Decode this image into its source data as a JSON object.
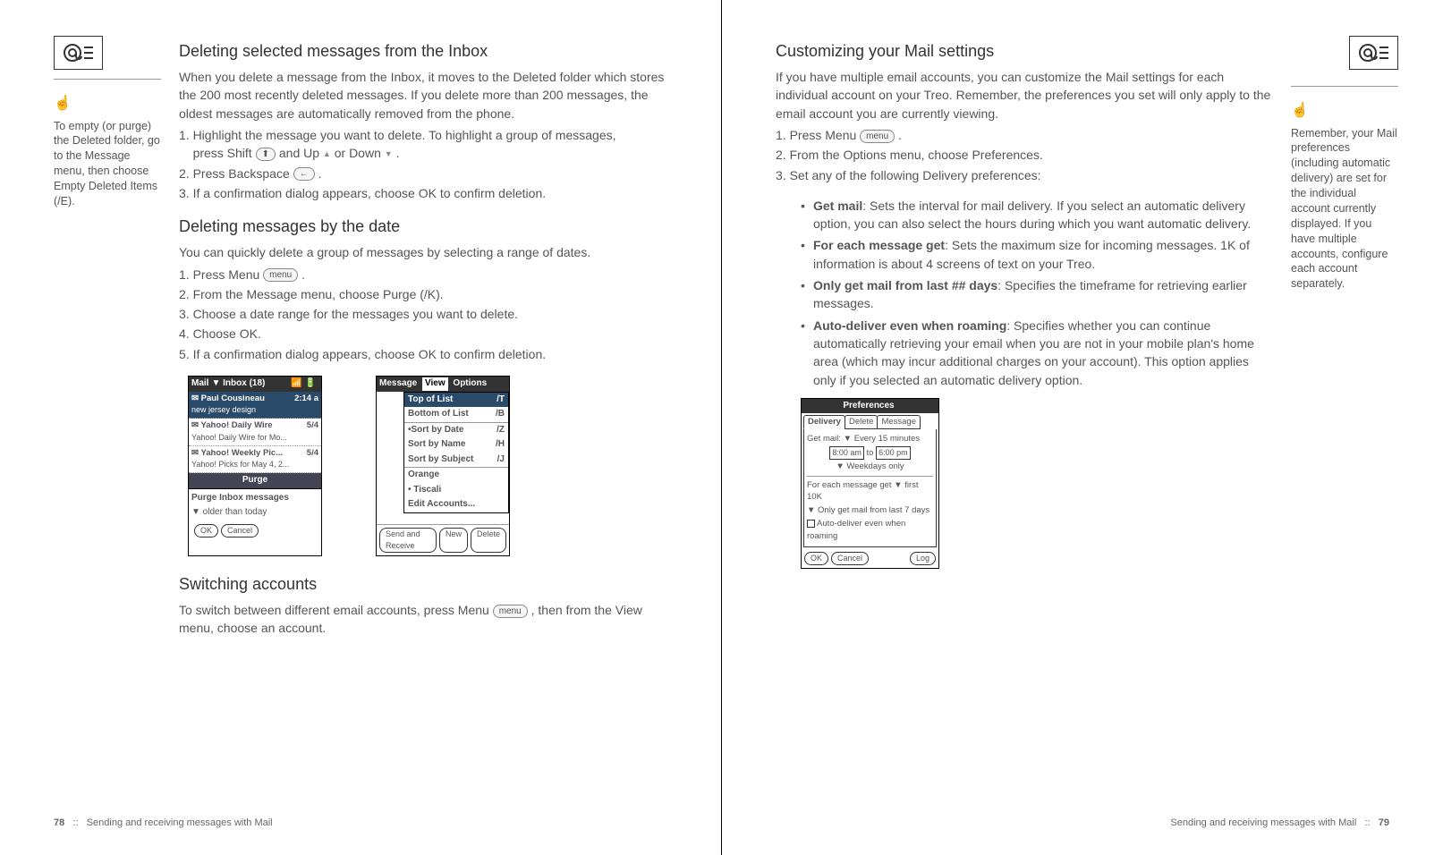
{
  "left_page": {
    "sidebar_tip": "To empty (or purge) the Deleted folder, go to the Message menu, then choose Empty Deleted Items (/E).",
    "h1": "Deleting selected messages from the Inbox",
    "p1": "When you delete a message from the Inbox, it moves to the Deleted folder which stores the 200 most recently deleted messages. If you delete more than 200 messages, the oldest messages are automatically removed from the phone.",
    "s1_li1a": "1.  Highlight the message you want to delete. To highlight a group of messages,",
    "s1_li1b": "press Shift",
    "s1_li1c": "and Up",
    "s1_li1d": "or Down",
    "s1_li2": "2.  Press Backspace",
    "s1_li3": "3.  If a confirmation dialog appears, choose OK to confirm deletion.",
    "h2": "Deleting messages by the date",
    "p2": "You can quickly delete a group of messages by selecting a range of dates.",
    "s2_li1": "1.  Press Menu",
    "s2_li2": "2.  From the Message menu, choose Purge (/K).",
    "s2_li3": "3.  Choose a date range for the messages you want to delete.",
    "s2_li4": "4.  Choose OK.",
    "s2_li5": "5.  If a confirmation dialog appears, choose OK to confirm deletion.",
    "h3": "Switching accounts",
    "p3a": "To switch between different email accounts, press Menu",
    "p3b": ", then from the View menu, choose an account.",
    "footer_num": "78",
    "footer_sep": "::",
    "footer_text": "Sending and receiving messages with Mail",
    "shot_a": {
      "title_mail": "Mail",
      "title_inbox": "▼ Inbox (18)",
      "r1_name": "Paul Cousineau",
      "r1_time": "2:14 a",
      "r1_sub": "new jersey design",
      "r2_name": "Yahoo! Daily Wire",
      "r2_date": "5/4",
      "r2_sub": "Yahoo! Daily Wire for Mo...",
      "r3_name": "Yahoo! Weekly Pic...",
      "r3_date": "5/4",
      "r3_sub": "Yahoo! Picks for May 4, 2...",
      "purge": "Purge",
      "dlg_title": "Purge Inbox messages",
      "dlg_opt": "▼ older than today",
      "ok": "OK",
      "cancel": "Cancel"
    },
    "shot_b": {
      "m1": "Message",
      "m2": "View",
      "m3": "Options",
      "top": "Top of List",
      "top_k": "/T",
      "bot": "Bottom of List",
      "bot_k": "/B",
      "date": "•Sort by Date",
      "date_k": "/Z",
      "name": "Sort by Name",
      "name_k": "/H",
      "subj": "Sort by Subject",
      "subj_k": "/J",
      "acc1": "Orange",
      "acc2": "• Tiscali",
      "acc3": "Edit Accounts...",
      "b1": "Send and Receive",
      "b2": "New",
      "b3": "Delete"
    }
  },
  "right_page": {
    "sidebar_tip": "Remember, your Mail preferences (including automatic delivery) are set for the individual account currently displayed. If you have multiple accounts, configure each account separately.",
    "h1": "Customizing your Mail settings",
    "p1": "If you have multiple email accounts, you can customize the Mail settings for each individual account on your Treo. Remember, the preferences you set will only apply to the email account you are currently viewing.",
    "s1_li1": "1.  Press Menu",
    "s1_li2": "2.  From the Options menu, choose Preferences.",
    "s1_li3": "3.  Set any of the following Delivery preferences:",
    "b1_label": "Get mail",
    "b1_text": ": Sets the interval for mail delivery. If you select an automatic delivery option, you can also select the hours during which you want automatic delivery.",
    "b2_label": "For each message get",
    "b2_text": ": Sets the maximum size for incoming messages. 1K of information is about 4 screens of text on your Treo.",
    "b3_label": "Only get mail from last ## days",
    "b3_text": ": Specifies the timeframe for retrieving earlier messages.",
    "b4_label": "Auto-deliver even when roaming",
    "b4_text": ": Specifies whether you can continue automatically retrieving your email when you are not in your mobile plan's home area (which may incur additional charges on your account). This option applies only if you selected an automatic delivery option.",
    "footer_text": "Sending and receiving messages with Mail",
    "footer_sep": "::",
    "footer_num": "79",
    "shot_c": {
      "title": "Preferences",
      "t1": "Delivery",
      "t2": "Delete",
      "t3": "Message",
      "r1": "Get mail: ▼ Every 15 minutes",
      "r2a": "8:00 am",
      "r2b": "to",
      "r2c": "6:00 pm",
      "r3": "▼ Weekdays only",
      "r4": "For each message get ▼ first 10K",
      "r5": "▼ Only get mail from last 7 days",
      "r6": "Auto-deliver even when roaming",
      "ok": "OK",
      "cancel": "Cancel",
      "log": "Log"
    }
  }
}
